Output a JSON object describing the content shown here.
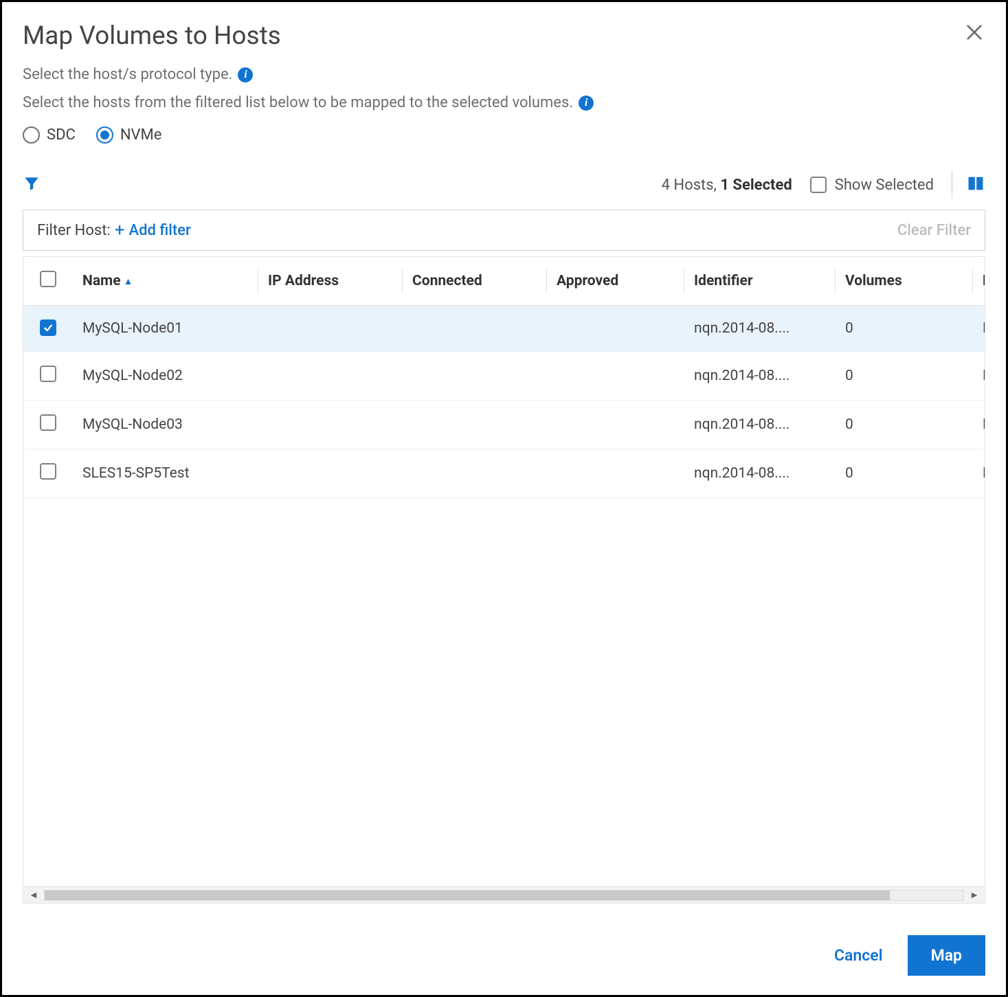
{
  "dialog": {
    "title": "Map Volumes to Hosts",
    "line1": "Select the host/s protocol type.",
    "line2": "Select the hosts from the filtered list below to be mapped to the selected volumes."
  },
  "protocol": {
    "options": [
      {
        "label": "SDC",
        "selected": false
      },
      {
        "label": "NVMe",
        "selected": true
      }
    ]
  },
  "toolbar": {
    "hosts_count_prefix": "4 Hosts, ",
    "selected_text": "1 Selected",
    "show_selected_label": "Show Selected"
  },
  "filter": {
    "label": "Filter Host:",
    "add_label": "Add filter",
    "clear_label": "Clear Filter"
  },
  "table": {
    "columns": {
      "name": "Name",
      "ip": "IP Address",
      "connected": "Connected",
      "approved": "Approved",
      "identifier": "Identifier",
      "volumes": "Volumes",
      "protocol": "Protocol"
    },
    "rows": [
      {
        "checked": true,
        "name": "MySQL-Node01",
        "ip": "",
        "connected": "",
        "approved": "",
        "identifier": "nqn.2014-08....",
        "volumes": "0",
        "protocol": "NVM"
      },
      {
        "checked": false,
        "name": "MySQL-Node02",
        "ip": "",
        "connected": "",
        "approved": "",
        "identifier": "nqn.2014-08....",
        "volumes": "0",
        "protocol": "NVM"
      },
      {
        "checked": false,
        "name": "MySQL-Node03",
        "ip": "",
        "connected": "",
        "approved": "",
        "identifier": "nqn.2014-08....",
        "volumes": "0",
        "protocol": "NVM"
      },
      {
        "checked": false,
        "name": "SLES15-SP5Test",
        "ip": "",
        "connected": "",
        "approved": "",
        "identifier": "nqn.2014-08....",
        "volumes": "0",
        "protocol": "NVM"
      }
    ]
  },
  "buttons": {
    "cancel": "Cancel",
    "map": "Map"
  }
}
